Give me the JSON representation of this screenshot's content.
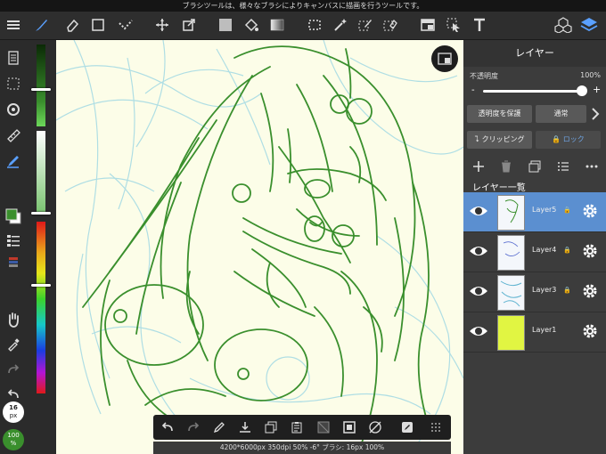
{
  "tip": "ブラシツールは、様々なブラシによりキャンバスに描画を行うツールです。",
  "toolbar": {
    "tools": [
      "menu-icon",
      "brush-icon",
      "eraser-icon",
      "rectangle-icon",
      "dot-brush-icon",
      "move-icon",
      "transform-icon",
      "fill-color-icon",
      "bucket-icon",
      "gradient-icon",
      "select-rect-icon",
      "magic-wand-icon",
      "select-pen-icon",
      "select-eraser-icon",
      "layout-icon",
      "select-move-icon",
      "text-icon",
      "3d-icon",
      "layers-icon"
    ]
  },
  "left": {
    "brush_size": "16",
    "brush_size_unit": "px",
    "opacity": "100",
    "opacity_unit": "%"
  },
  "colors": {
    "primary": "#3a8f2d",
    "accent": "#5b8fd0",
    "canvas": "#fcfde8"
  },
  "panel": {
    "title": "レイヤー",
    "opacity_label": "不透明度",
    "opacity_value": "100%",
    "opacity_fraction": 1.0,
    "minus": "-",
    "plus": "+",
    "protect_alpha": "透明度を保護",
    "blend_mode": "通常",
    "clipping": "クリッピング",
    "lock": "ロック",
    "list_title": "レイヤー一覧",
    "layers": [
      {
        "name": "Layer5",
        "locked": true,
        "selected": true
      },
      {
        "name": "Layer4",
        "locked": true,
        "selected": false
      },
      {
        "name": "Layer3",
        "locked": true,
        "selected": false
      },
      {
        "name": "Layer1",
        "locked": false,
        "selected": false
      }
    ]
  },
  "status": "4200*6000px 350dpi 50% -6° ブラシ: 16px 100%"
}
